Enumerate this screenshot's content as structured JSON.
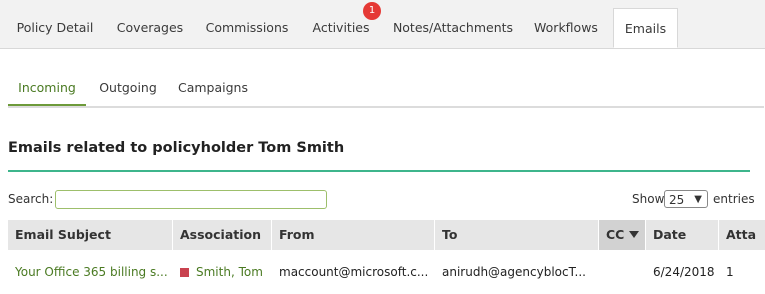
{
  "top_tabs": [
    {
      "label": "Policy Detail"
    },
    {
      "label": "Coverages"
    },
    {
      "label": "Commissions"
    },
    {
      "label": "Activities",
      "badge": "1"
    },
    {
      "label": "Notes/Attachments"
    },
    {
      "label": "Workflows"
    },
    {
      "label": "Emails",
      "active": true
    }
  ],
  "sub_tabs": [
    {
      "label": "Incoming",
      "active": true
    },
    {
      "label": "Outgoing"
    },
    {
      "label": "Campaigns"
    }
  ],
  "heading": "Emails related to policyholder Tom Smith",
  "search": {
    "label": "Search:",
    "value": ""
  },
  "length": {
    "show_label": "Show",
    "value": "25",
    "entries_label": "entries"
  },
  "columns": [
    "Email Subject",
    "Association",
    "From",
    "To",
    "CC",
    "Date",
    "Atta"
  ],
  "rows": [
    {
      "subject": "Your Office 365 billing s...",
      "association": "Smith, Tom",
      "from": "maccount@microsoft.c...",
      "to": "anirudh@agencyblocT...",
      "cc": "",
      "date": "6/24/2018",
      "attachments": "1"
    }
  ],
  "colors": {
    "accent_green": "#4a7a22",
    "rule_teal": "#3db58c",
    "badge_red": "#e53935",
    "assoc_red": "#c9424f"
  }
}
